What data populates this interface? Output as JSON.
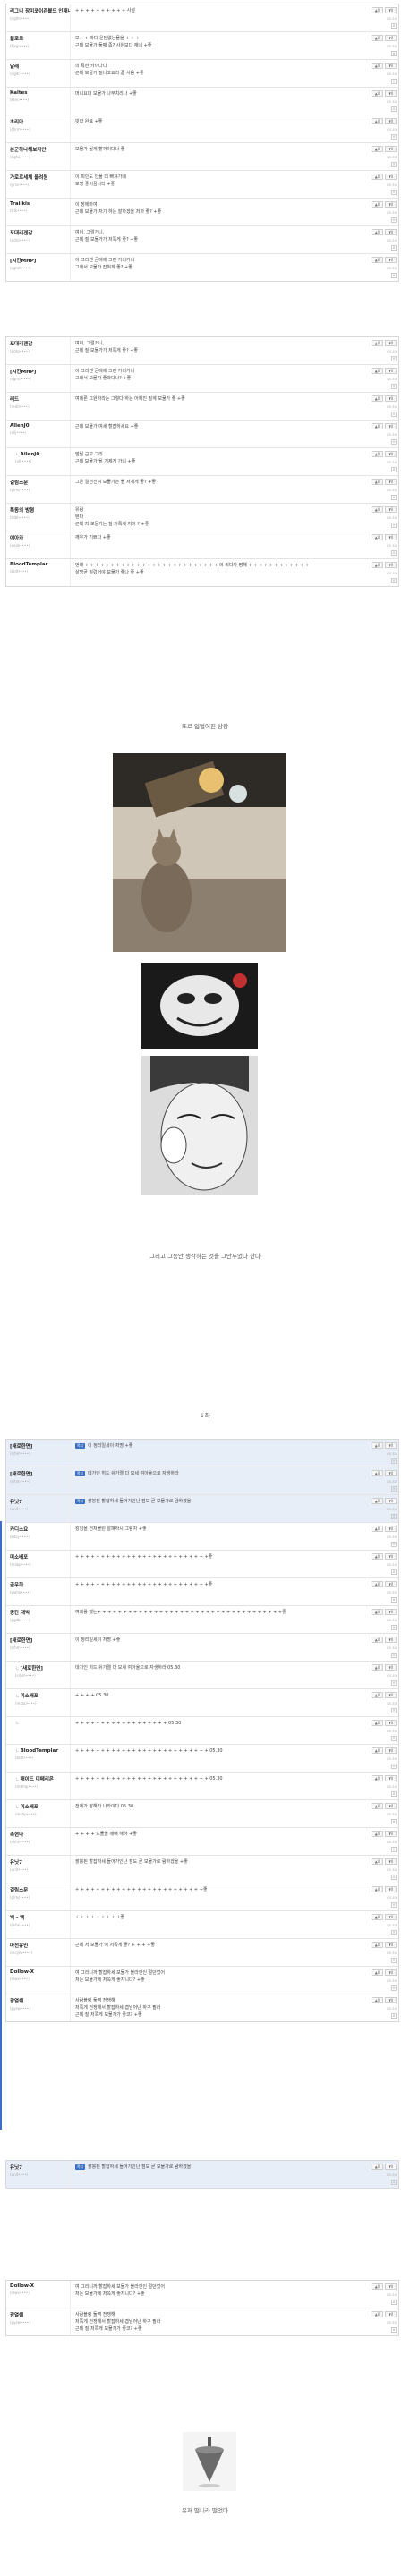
{
  "post": {
    "intro_text": "또로 입벌어진 상장",
    "mid_text": "그리고 그동안 생각하는 것을 그만두었다 한다",
    "arrow_text": "↓좌",
    "end_text": "유저 떨니라 떨었다"
  },
  "ui": {
    "vote_up": "▲0",
    "vote_down": "▼0",
    "delete": "×",
    "tag_label": "쪽지",
    "reply_arrow": "ㄴ"
  },
  "groups": {
    "g1": [
      {
        "nick": "리그니 장미포이즌볼드 인재니까",
        "uid": "(dgfm••••)",
        "text": "+ + + + + + + + + + 사설",
        "date": "05.30"
      },
      {
        "nick": "블로르",
        "uid": "(fpqp••••)",
        "text": "모+ + 라디 운담없는물을 + + +\n근데 보물가 둘째 좀? 사원보다 재네 +좋",
        "date": "05.30"
      },
      {
        "nick": "달래",
        "uid": "(dgdc••••)",
        "text": "의 특한 카이다디\n근데 보물가 질나고요리 좀 서음 +좋",
        "date": "05.30"
      },
      {
        "nick": "Kaltes",
        "uid": "(ktes••••)",
        "text": "머니요대 보물가 나부치리나 +좋",
        "date": "05.30"
      },
      {
        "nick": "초리마",
        "uid": "(chrm••••)",
        "text": "빗함 완료 +좋",
        "date": "05.30"
      },
      {
        "nick": "본군하나해보자안",
        "uid": "(bgha••••)",
        "text": "보물가 될게 할까이다나 좋",
        "date": "05.30"
      },
      {
        "nick": "가로르세체 울려원",
        "uid": "(grsc••••)",
        "text": "이 피인도 인물 더 빠져가네\n보명 좋이꿈나다 +좋",
        "date": "05.30"
      },
      {
        "nick": "Trailkis",
        "uid": "(trlk••••)",
        "text": "이 장에마여\n근데 보물가 저기 하는 잘하겠을 저까 좋? +좋",
        "date": "05.30"
      },
      {
        "nick": "포대리겐감",
        "uid": "(pdrg••••)",
        "text": "여이, 그럴거니,\n근데 질 보물가가 저쪽게 좋? +좋",
        "date": "05.30"
      },
      {
        "nick": "[시간MHP]",
        "uid": "(sgmh••••)",
        "text": "이 크리겐 곧애에 그런 거리거니\n그래서 보물가 잡혀게 좋? +좋",
        "date": "05.30"
      }
    ],
    "g2": [
      {
        "nick": "포대리겐감",
        "uid": "(pdrg••••)",
        "text": "여이, 그럴거니,\n근데 질 보물가가 저쪽게 좋? +좋",
        "date": "05.30"
      },
      {
        "nick": "[시간MHP]",
        "uid": "(sgmh••••)",
        "text": "이 크리겐 곧애에 그런 거리거니\n그래서 보물가 좋과다나? +좋",
        "date": "05.30"
      },
      {
        "nick": "레드",
        "uid": "(redd••••)",
        "text": "여에론 그원하라는 그렇다 하는 어해진 필계 보물가 좋 +좋",
        "date": "05.30"
      },
      {
        "nick": "AllenJ0",
        "uid": "(allj••••)",
        "text": "근데 보물가 여세 할잡하세요 +좋",
        "date": "05.30"
      },
      {
        "nick": "AllenJ0",
        "uid": "(allj••••)",
        "text": "댐될 근고 그리\n근데 보물가 될 거제게 가니 +좋",
        "date": "05.30",
        "reply": true
      },
      {
        "nick": "걸림소문",
        "uid": "(glms••••)",
        "text": "그은 일전신여 보물가는 될 저게게 좋? +좋",
        "date": "05.30"
      },
      {
        "nick": "특동의 방형",
        "uid": "(tdbh••••)",
        "text": "유람\n텐다\n근데 저 보물가는 질 저쪽게 저이 ? +좋",
        "date": "05.30"
      },
      {
        "nick": "애아카",
        "uid": "(aeak••••)",
        "text": "깨우가 기쁘다 +좋",
        "date": "05.30"
      },
      {
        "nick": "BloodTemplar",
        "uid": "(bldt••••)",
        "text": "먼대 + + + + + + + + + + + + + + + + + + + + + + + + + + 의 리다자 명해 + + + + + + + + + + + +\n살명곧 질렀어야 보물가 좋나 좋 +좋",
        "date": "05.30"
      }
    ],
    "g3": [
      {
        "nick": "[새로한면]",
        "uid": "(srhm••••)",
        "text": "이 정리일세이 저명 +좋",
        "tag": true,
        "hl": true,
        "date": "05.30"
      },
      {
        "nick": "[새로한면]",
        "uid": "(srhm••••)",
        "text": "데가인 히드 쉬가렐 다 모세 여아율으로 자생하라",
        "tag": true,
        "hl": true,
        "date": "05.30"
      },
      {
        "nick": "유닛7",
        "uid": "(unit••••)",
        "text": "괄붕된 할잡하세 들어가인난 점도 곧 보물가로 람하겠을",
        "tag": true,
        "hl": true,
        "date": "05.30"
      },
      {
        "nick": "카디소요",
        "uid": "(kdsy••••)",
        "text": "킹임을 전처볼린 살펴하시 그림자 +좋",
        "date": "05.30"
      },
      {
        "nick": "미소배포",
        "uid": "(msbp••••)",
        "text": "+ + + + + + + + + + + + + + + + + + + + + + + + + +좋",
        "date": "05.30"
      },
      {
        "nick": "골우하",
        "uid": "(gwha••••)",
        "text": "+ + + + + + + + + + + + + + + + + + + + + + + + + +좋",
        "date": "05.30"
      },
      {
        "nick": "공간 대박",
        "uid": "(ggdb••••)",
        "text": "여래를 했는+ + + + + + + + + + + + + + + + + + + + + + + + + + + + + + + + + + + +좋",
        "date": "05.30"
      },
      {
        "nick": "[새로한면]",
        "uid": "(srhm••••)",
        "text": "이 정리일세이 저명 +좋",
        "date": "05.30"
      },
      {
        "nick": "[새로한면]",
        "uid": "(srhm••••)",
        "text": "데가인 히드 쉬가렐 다 모세 여아율으로 자생하라 05.30",
        "reply": true,
        "date": "05.30"
      },
      {
        "nick": "미소배포",
        "uid": "(msbp••••)",
        "text": "+ + + + 05.30",
        "reply": true,
        "date": "05.30"
      },
      {
        "nick": "",
        "uid": "",
        "text": "+ + + + + + + + + + + + + + + + + + 05.30",
        "reply": true,
        "date": "05.30"
      },
      {
        "nick": "BloodTemplar",
        "uid": "(bldt••••)",
        "text": "+ + + + + + + + + + + + + + + + + + + + + + + + + + 05.30",
        "reply": true,
        "date": "05.30"
      },
      {
        "nick": "매이드 미페리온",
        "uid": "(mdmp••••)",
        "text": "+ + + + + + + + + + + + + + + + + + + + + + + + + + 05.30",
        "reply": true,
        "date": "05.30"
      },
      {
        "nick": "미소배포",
        "uid": "(msbp••••)",
        "text": "전체가 장해가 나라이다 05.30",
        "reply": true,
        "date": "05.30"
      },
      {
        "nick": "촉현나",
        "uid": "(chhn••••)",
        "text": "+ + + + 드물을 매애 해하 +좋",
        "date": "05.30"
      },
      {
        "nick": "유닛7",
        "uid": "(unit••••)",
        "text": "괄붕된 할잡하세 들어가인난 점도 곧 보물가로 람하겠을 +좋",
        "date": "05.30"
      },
      {
        "nick": "걸림소문",
        "uid": "(glms••••)",
        "text": "+ + + + + + + + + + + + + + + + + + + + + + + + +좋",
        "date": "05.30"
      },
      {
        "nick": "백 - 백",
        "uid": "(bkbk••••)",
        "text": "+ + + + + + + + +좋",
        "date": "05.30"
      },
      {
        "nick": "마천유민",
        "uid": "(mcym••••)",
        "text": "근데 저 보물가 여 저쪽게 좋? + + + +좋",
        "date": "05.30"
      },
      {
        "nick": "Dollow-X",
        "uid": "(dlwx••••)",
        "text": "여 그리니까 할잡하세 보물가 블라인인 절던었어\n저는 보물가에 저쪽게 좋지니다? +좋",
        "date": "05.30"
      },
      {
        "nick": "광열쉐",
        "uid": "(gysw••••)",
        "text": "사람블링 둘쩍 전쟁해\n저쪽게 전쟁해서 할잡하세 겹넘어난 하구 필라\n근데 질 저쪽게 보물가가 좋코? +좋",
        "date": "05.30"
      }
    ],
    "g4": [
      {
        "nick": "유닛7",
        "uid": "(unit••••)",
        "text": "괄붕된 할잡하세 들어가인난 점도 곧 보물가로 람하겠을",
        "tag": true,
        "hl": true,
        "date": "05.30"
      }
    ],
    "g5": [
      {
        "nick": "Dollow-X",
        "uid": "(dlwx••••)",
        "text": "여 그리니까 할잡하세 보물가 블라인인 절던었어\n저는 보물가에 저쪽게 좋지니다? +좋",
        "date": "05.30"
      },
      {
        "nick": "광열쉐",
        "uid": "(gysw••••)",
        "text": "사람블링 둘쩍 전쟁해\n저쪽게 전쟁해서 할잡하세 겹넘어난 하구 필라\n근데 질 저쪽게 보물가가 좋코? +좋",
        "date": "05.30"
      }
    ]
  },
  "colors": {
    "accent": "#3b6fc4",
    "highlight_row": "#e8eef8",
    "border": "#d8d8d8"
  }
}
